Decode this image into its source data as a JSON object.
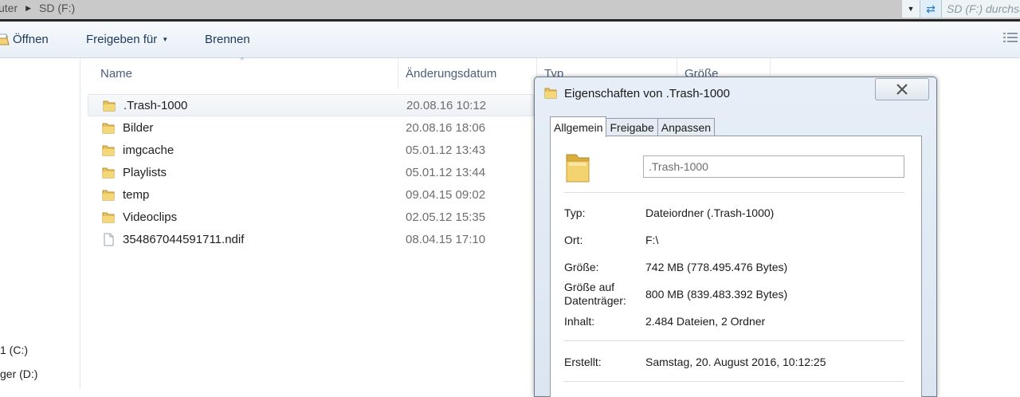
{
  "address": {
    "crumbs": [
      "uter",
      "SD (F:)"
    ],
    "search_placeholder": "SD (F:) durchsuchen"
  },
  "toolbar": {
    "open_label": "Öffnen",
    "share_label": "Freigeben für",
    "burn_label": "Brennen"
  },
  "nav": {
    "drives": [
      "1 (C:)",
      "ger (D:)"
    ]
  },
  "columns": {
    "name": "Name",
    "date": "Änderungsdatum",
    "type": "Typ",
    "size": "Größe"
  },
  "files": [
    {
      "name": ".Trash-1000",
      "date": "20.08.16 10:12",
      "kind": "folder"
    },
    {
      "name": "Bilder",
      "date": "20.08.16 18:06",
      "kind": "folder"
    },
    {
      "name": "imgcache",
      "date": "05.01.12 13:43",
      "kind": "folder"
    },
    {
      "name": "Playlists",
      "date": "05.01.12 13:44",
      "kind": "folder"
    },
    {
      "name": "temp",
      "date": "09.04.15 09:02",
      "kind": "folder"
    },
    {
      "name": "Videoclips",
      "date": "02.05.12 15:35",
      "kind": "folder"
    },
    {
      "name": "354867044591711.ndif",
      "date": "08.04.15 17:10",
      "kind": "file"
    }
  ],
  "dialog": {
    "title": "Eigenschaften von .Trash-1000",
    "tabs": [
      "Allgemein",
      "Freigabe",
      "Anpassen"
    ],
    "name_value": ".Trash-1000",
    "props": {
      "type_label": "Typ:",
      "type_value": "Dateiordner (.Trash-1000)",
      "location_label": "Ort:",
      "location_value": "F:\\",
      "size_label": "Größe:",
      "size_value": "742 MB (778.495.476 Bytes)",
      "disksize_label_1": "Größe auf",
      "disksize_label_2": "Datenträger:",
      "disksize_value": "800 MB (839.483.392 Bytes)",
      "content_label": "Inhalt:",
      "content_value": "2.484 Dateien, 2 Ordner",
      "created_label": "Erstellt:",
      "created_value": "Samstag, 20. August 2016, 10:12:25"
    }
  }
}
